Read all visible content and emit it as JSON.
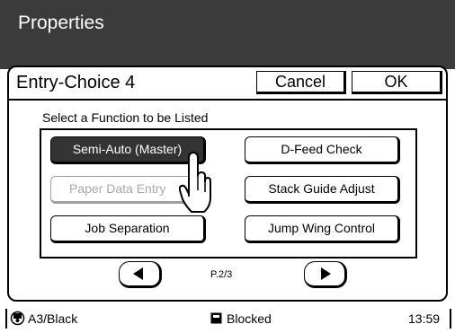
{
  "header": {
    "title": "Properties"
  },
  "panel": {
    "title": "Entry-Choice 4",
    "cancel_label": "Cancel",
    "ok_label": "OK",
    "instruction": "Select a Function to be Listed"
  },
  "functions": [
    {
      "label": "Semi-Auto (Master)",
      "state": "selected"
    },
    {
      "label": "D-Feed Check",
      "state": "normal"
    },
    {
      "label": "Paper Data Entry",
      "state": "disabled"
    },
    {
      "label": "Stack Guide Adjust",
      "state": "normal"
    },
    {
      "label": "Job Separation",
      "state": "normal"
    },
    {
      "label": "Jump Wing Control",
      "state": "normal"
    }
  ],
  "pagination": {
    "indicator": "P.2/3"
  },
  "status": {
    "paper": "A3/Black",
    "state": "Blocked",
    "time": "13:59"
  },
  "colors": {
    "header_bg": "#3b3b3b",
    "selected_bg": "#333333",
    "disabled_text": "#a8a8a8"
  }
}
